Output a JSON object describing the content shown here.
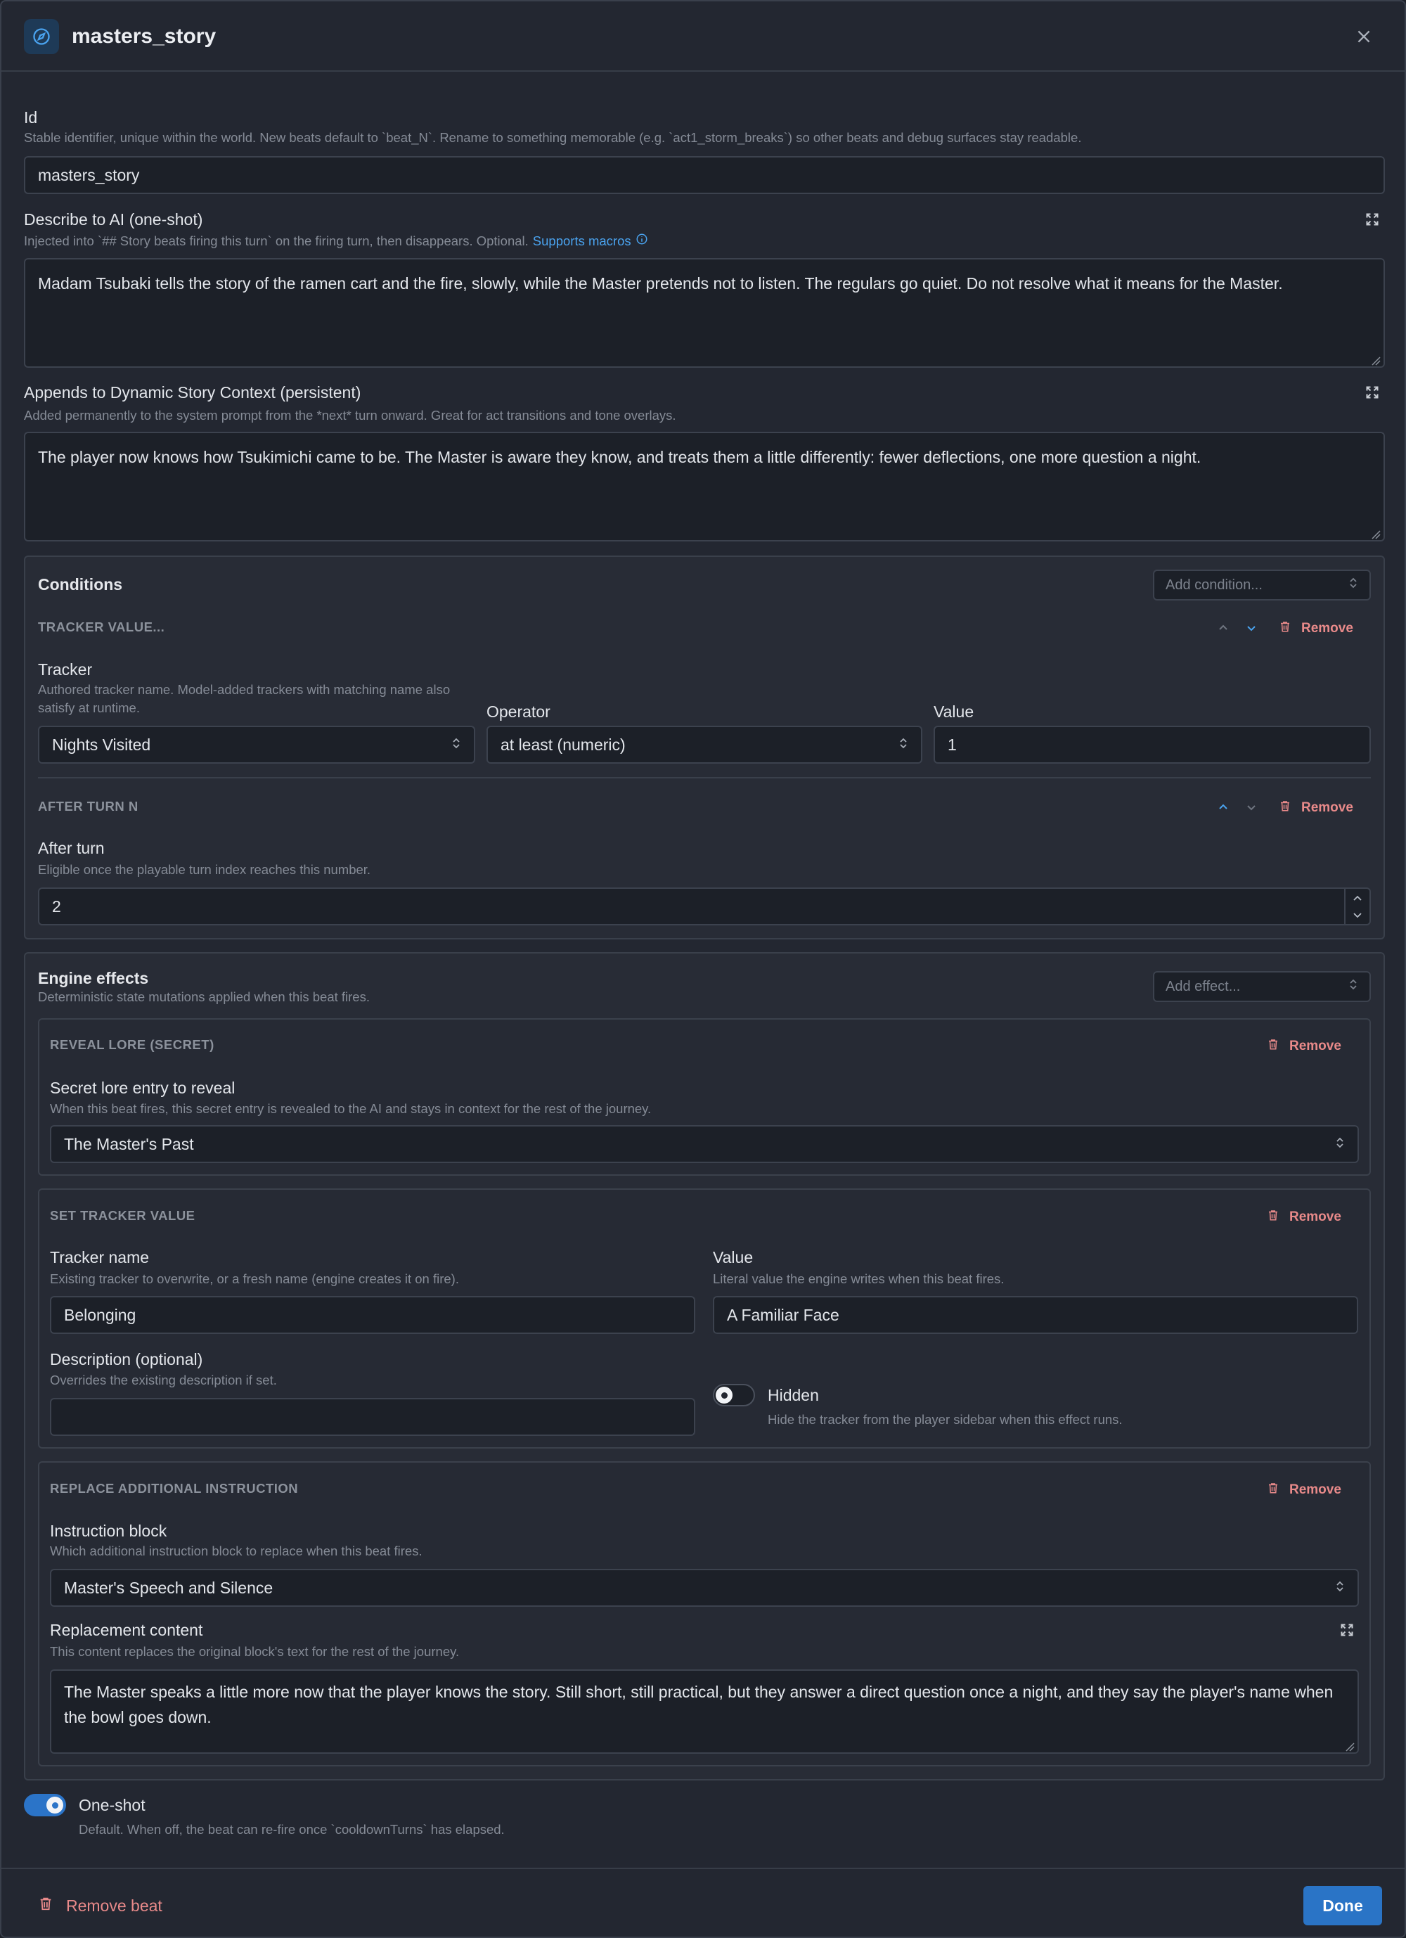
{
  "header": {
    "title": "masters_story",
    "icon": "compass-icon"
  },
  "id_field": {
    "label": "Id",
    "help": "Stable identifier, unique within the world. New beats default to `beat_N`. Rename to something memorable (e.g. `act1_storm_breaks`) so other beats and debug surfaces stay readable.",
    "value": "masters_story"
  },
  "describe_ai": {
    "label": "Describe to AI (one-shot)",
    "help": "Injected into `## Story beats firing this turn` on the firing turn, then disappears. Optional.",
    "help_link": "Supports macros",
    "value": "Madam Tsubaki tells the story of the ramen cart and the fire, slowly, while the Master pretends not to listen. The regulars go quiet. Do not resolve what it means for the Master."
  },
  "dynamic_context": {
    "label": "Appends to Dynamic Story Context (persistent)",
    "help": "Added permanently to the system prompt from the *next* turn onward. Great for act transitions and tone overlays.",
    "value": "The player now knows how Tsukimichi came to be. The Master is aware they know, and treats them a little differently: fewer deflections, one more question a night."
  },
  "conditions": {
    "title": "Conditions",
    "add_placeholder": "Add condition...",
    "tracker_value": {
      "heading": "TRACKER VALUE...",
      "remove": "Remove",
      "tracker_label": "Tracker",
      "tracker_help": "Authored tracker name. Model-added trackers with matching name also satisfy at runtime.",
      "tracker_value": "Nights Visited",
      "operator_label": "Operator",
      "operator_value": "at least (numeric)",
      "value_label": "Value",
      "value_value": "1"
    },
    "after_turn": {
      "heading": "AFTER TURN N",
      "remove": "Remove",
      "label": "After turn",
      "help": "Eligible once the playable turn index reaches this number.",
      "value": "2"
    }
  },
  "effects": {
    "title": "Engine effects",
    "help": "Deterministic state mutations applied when this beat fires.",
    "add_placeholder": "Add effect...",
    "reveal_lore": {
      "heading": "REVEAL LORE (SECRET)",
      "remove": "Remove",
      "label": "Secret lore entry to reveal",
      "help": "When this beat fires, this secret entry is revealed to the AI and stays in context for the rest of the journey.",
      "value": "The Master's Past"
    },
    "set_tracker": {
      "heading": "SET TRACKER VALUE",
      "remove": "Remove",
      "name_label": "Tracker name",
      "name_help": "Existing tracker to overwrite, or a fresh name (engine creates it on fire).",
      "name_value": "Belonging",
      "value_label": "Value",
      "value_help": "Literal value the engine writes when this beat fires.",
      "value_value": "A Familiar Face",
      "desc_label": "Description (optional)",
      "desc_help": "Overrides the existing description if set.",
      "desc_value": "",
      "hidden_label": "Hidden",
      "hidden_help": "Hide the tracker from the player sidebar when this effect runs."
    },
    "replace_instruction": {
      "heading": "REPLACE ADDITIONAL INSTRUCTION",
      "remove": "Remove",
      "block_label": "Instruction block",
      "block_help": "Which additional instruction block to replace when this beat fires.",
      "block_value": "Master's Speech and Silence",
      "content_label": "Replacement content",
      "content_help": "This content replaces the original block's text for the rest of the journey.",
      "content_value": "The Master speaks a little more now that the player knows the story. Still short, still practical, but they answer a direct question once a night, and they say the player's name when the bowl goes down."
    }
  },
  "one_shot": {
    "label": "One-shot",
    "help": "Default. When off, the beat can re-fire once `cooldownTurns` has elapsed."
  },
  "footer": {
    "remove_beat": "Remove beat",
    "done": "Done"
  },
  "colors": {
    "accent": "#2a74c6",
    "danger": "#e98a8a",
    "link": "#4aa3ef"
  }
}
